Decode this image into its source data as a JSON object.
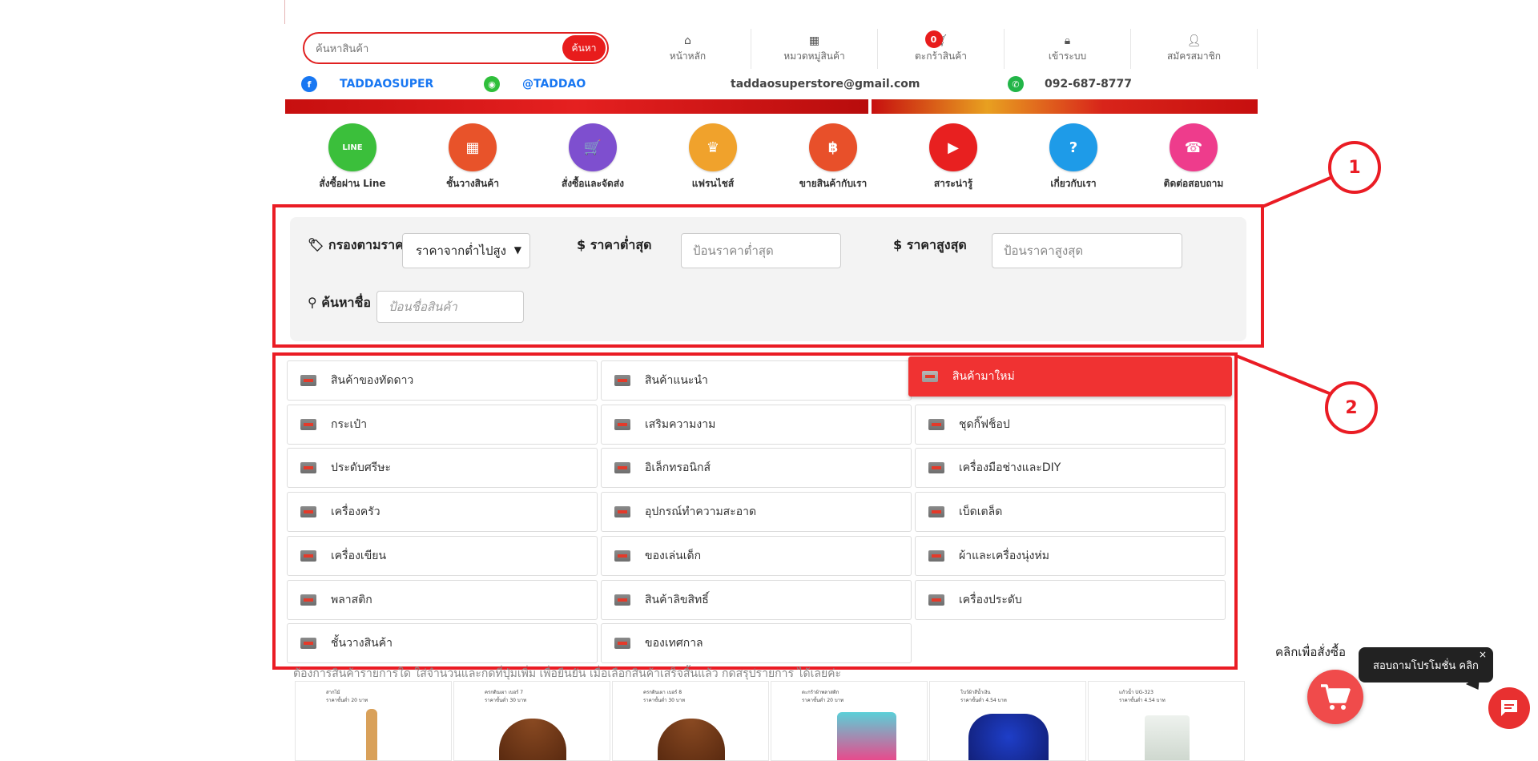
{
  "header": {
    "search": {
      "placeholder": "ค้นหาสินค้า",
      "button": "ค้นหา"
    },
    "nav": [
      {
        "label": "หน้าหลัก",
        "icon": "home-icon"
      },
      {
        "label": "หมวดหมู่สินค้า",
        "icon": "grid-icon"
      },
      {
        "label": "ตะกร้าสินค้า",
        "icon": "cart-icon",
        "badge": "0"
      },
      {
        "label": "เข้าระบบ",
        "icon": "lock-icon"
      },
      {
        "label": "สมัครสมาชิก",
        "icon": "add-user-icon"
      }
    ],
    "contacts": {
      "facebook": "TADDAOSUPER",
      "line": "@TADDAO",
      "email": "taddaosuperstore@gmail.com",
      "phone": "092-687-8777"
    }
  },
  "shortcuts": [
    {
      "label": "สั่งซื้อผ่าน Line",
      "color": "#3bbf3b",
      "glyph": "LINE"
    },
    {
      "label": "ชั้นวางสินค้า",
      "color": "#e8532a",
      "glyph": "▦"
    },
    {
      "label": "สั่งซื้อและจัดส่ง",
      "color": "#7e4fcf",
      "glyph": "🛒"
    },
    {
      "label": "แฟรนไชส์",
      "color": "#f0a22c",
      "glyph": "♛"
    },
    {
      "label": "ขายสินค้ากับเรา",
      "color": "#e8502a",
      "glyph": "฿"
    },
    {
      "label": "สาระน่ารู้",
      "color": "#e82020",
      "glyph": "▶"
    },
    {
      "label": "เกี่ยวกับเรา",
      "color": "#1e9be8",
      "glyph": "?"
    },
    {
      "label": "ติดต่อสอบถาม",
      "color": "#ee3c8c",
      "glyph": "☎"
    }
  ],
  "filter": {
    "price_filter_label": "กรองตามราคา",
    "sort_value": "ราคาจากต่ำไปสูง",
    "min_label": "ราคาต่ำสุด",
    "min_placeholder": "ป้อนราคาต่ำสุด",
    "max_label": "ราคาสูงสุด",
    "max_placeholder": "ป้อนราคาสูงสุด",
    "name_label": "ค้นหาชื่อ",
    "name_placeholder": "ป้อนชื่อสินค้า"
  },
  "categories": [
    "สินค้าของทัดดาว",
    "สินค้าแนะนำ",
    "สินค้ามาใหม่",
    "กระเป๋า",
    "เสริมความงาม",
    "ชุดกิ๊ฟช็อป",
    "ประดับศรีษะ",
    "อิเล็กทรอนิกส์",
    "เครื่องมือช่างและDIY",
    "เครื่องครัว",
    "อุปกรณ์ทำความสะอาด",
    "เบ็ดเตล็ด",
    "เครื่องเขียน",
    "ของเล่นเด็ก",
    "ผ้าและเครื่องนุ่งห่ม",
    "พลาสติก",
    "สินค้าลิขสิทธิ์",
    "เครื่องประดับ",
    "ชั้นวางสินค้า",
    "ของเทศกาล"
  ],
  "active_category": "สินค้ามาใหม่",
  "annotations": [
    "1",
    "2"
  ],
  "note": "ต้องการสินค้ารายการใด ใส่จำนวนและกดที่ปุ่มเพิ่ม เพื่อยืนยัน เมื่อเลือกสินค้าเสร็จสิ้นแล้ว กดสรุปรายการ ได้เลยค่ะ",
  "products": [
    {
      "title": "สากไม้",
      "price": "ราคาขั้นต่ำ 20 บาท"
    },
    {
      "title": "ครกดินเผา เบอร์ 7",
      "price": "ราคาขั้นต่ำ 30 บาท"
    },
    {
      "title": "ครกดินเผา เบอร์ 8",
      "price": "ราคาขั้นต่ำ 30 บาท"
    },
    {
      "title": "ตะกร้าผ้าพลาสติก",
      "price": "ราคาขั้นต่ำ 20 บาท"
    },
    {
      "title": "โบว์ผ้าสีน้ำเงิน",
      "price": "ราคาขั้นต่ำ 4.54 บาท"
    },
    {
      "title": "แก้วน้ำ UG-323",
      "price": "ราคาขั้นต่ำ 4.54 บาท"
    }
  ],
  "widgets": {
    "order_text": "คลิกเพื่อสั่งซื้อ",
    "promo_text": "สอบถามโปรโมชั่น คลิก",
    "promo_close": "×"
  }
}
